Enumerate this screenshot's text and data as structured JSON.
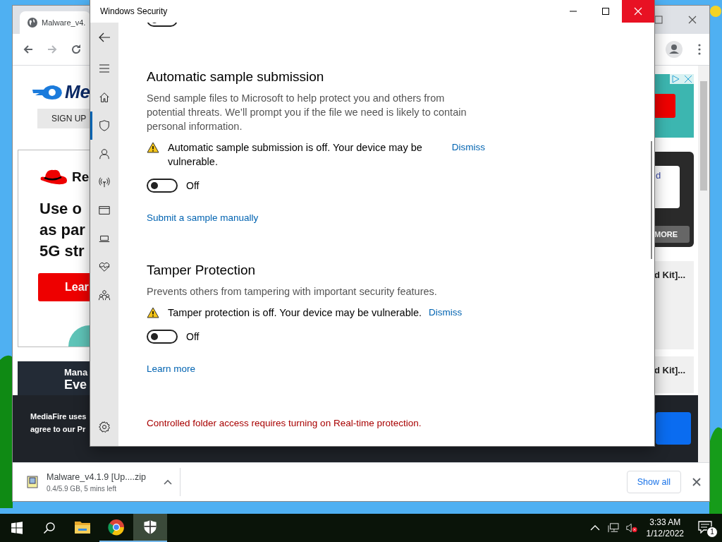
{
  "browser": {
    "tab_title": "Malware_v4.",
    "page": {
      "logo_text": "Me",
      "sign_up": "SIGN UP",
      "ad": {
        "brand": "Re",
        "lines": [
          "Use o",
          "as par",
          "5G str"
        ],
        "button": "Lear"
      },
      "banner": [
        "Mana",
        "Eve"
      ],
      "cookie_notice": [
        "MediaFire uses",
        "agree to our Pr"
      ],
      "side_card": {
        "text": "d",
        "button": "MORE"
      },
      "file_items": [
        "d Kit]...",
        "d Kit]..."
      ]
    },
    "download": {
      "file": "Malware_v4.1.9 [Up....zip",
      "status": "0.4/5.9 GB, 5 mins left",
      "show_all": "Show all"
    }
  },
  "security_window": {
    "title": "Windows Security",
    "nav": [
      {
        "selected": false
      },
      {
        "selected": true
      },
      {
        "selected": false
      },
      {
        "selected": false
      },
      {
        "selected": false
      },
      {
        "selected": false
      },
      {
        "selected": false
      },
      {
        "selected": false
      }
    ],
    "top_toggle": {
      "on": false
    },
    "sections": [
      {
        "title": "Automatic sample submission",
        "description": "Send sample files to Microsoft to help protect you and others from potential threats. We’ll prompt you if the file we need is likely to contain personal information.",
        "warning": "Automatic sample submission is off. Your device may be vulnerable.",
        "dismiss": "Dismiss",
        "toggle": {
          "on": false,
          "label": "Off"
        },
        "link": "Submit a sample manually"
      },
      {
        "title": "Tamper Protection",
        "description": "Prevents others from tampering with important security features.",
        "warning": "Tamper protection is off. Your device may be vulnerable.",
        "dismiss": "Dismiss",
        "toggle": {
          "on": false,
          "label": "Off"
        },
        "link": "Learn more"
      }
    ],
    "error": "Controlled folder access requires turning on Real-time protection."
  },
  "taskbar": {
    "apps": [
      {
        "selected": false
      },
      {
        "selected": false
      },
      {
        "selected": true
      }
    ],
    "time": "3:33 AM",
    "date": "1/12/2022",
    "notification_count": "1"
  }
}
